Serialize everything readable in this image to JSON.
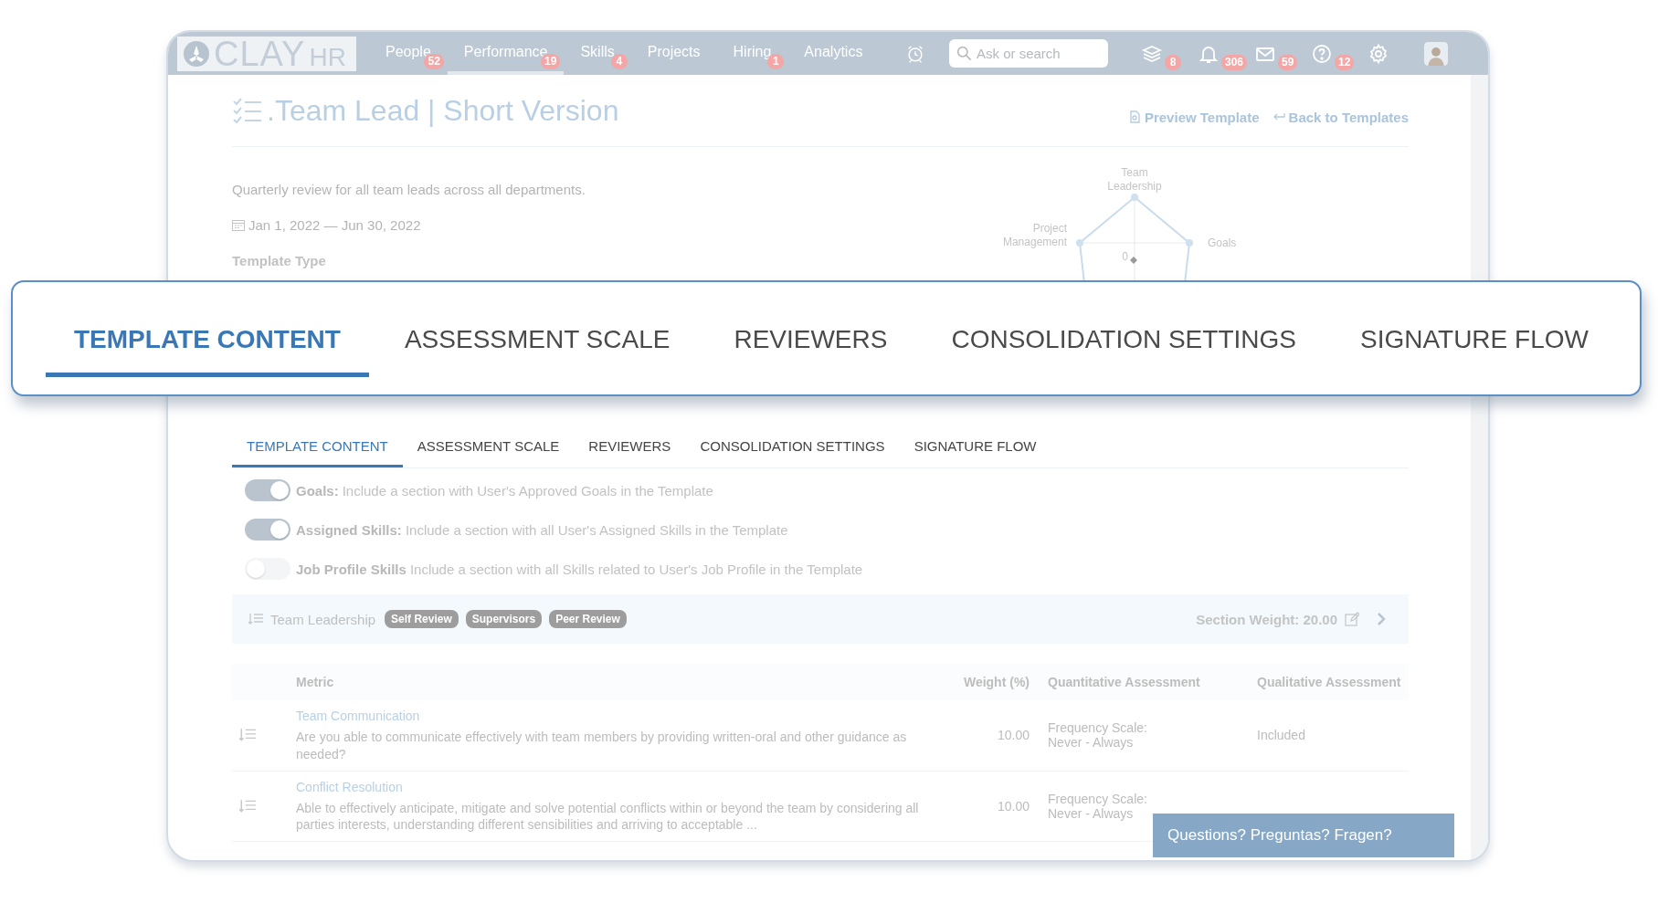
{
  "header": {
    "logo": {
      "text": "CLAY",
      "suffix": "HR"
    },
    "nav": [
      {
        "label": "People",
        "badge": "52",
        "selected": false
      },
      {
        "label": "Performance",
        "badge": "19",
        "selected": true
      },
      {
        "label": "Skills",
        "badge": "4",
        "selected": false
      },
      {
        "label": "Projects",
        "selected": false
      },
      {
        "label": "Hiring",
        "badge": "1",
        "selected": false
      },
      {
        "label": "Analytics",
        "selected": false
      }
    ],
    "search": {
      "placeholder": "Ask or search"
    },
    "icons": [
      {
        "kind": "layers",
        "badge": "8"
      },
      {
        "kind": "bell",
        "badge": "306"
      },
      {
        "kind": "mail",
        "badge": "59"
      },
      {
        "kind": "help",
        "badge": "12"
      },
      {
        "kind": "settings"
      },
      {
        "kind": "avatar"
      }
    ]
  },
  "page": {
    "title": ".Team Lead | Short Version",
    "actions": [
      {
        "kind": "preview",
        "label": "Preview Template"
      },
      {
        "kind": "back",
        "label": "Back to Templates"
      }
    ],
    "description": "Quarterly review for all team leads across all departments.",
    "date_range": "Jan 1, 2022 — Jun 30, 2022",
    "template_type_label": "Template Type"
  },
  "radar": {
    "labels": [
      "Team Leadership",
      "Goals",
      "Project Management"
    ],
    "center": "0"
  },
  "zoomed_tabs": [
    {
      "label": "TEMPLATE CONTENT",
      "selected": true
    },
    {
      "label": "ASSESSMENT SCALE",
      "selected": false
    },
    {
      "label": "REVIEWERS",
      "selected": false
    },
    {
      "label": "CONSOLIDATION SETTINGS",
      "selected": false
    },
    {
      "label": "SIGNATURE FLOW",
      "selected": false
    }
  ],
  "tabs": [
    {
      "label": "TEMPLATE CONTENT",
      "selected": true
    },
    {
      "label": "ASSESSMENT SCALE",
      "selected": false
    },
    {
      "label": "REVIEWERS",
      "selected": false
    },
    {
      "label": "CONSOLIDATION SETTINGS",
      "selected": false
    },
    {
      "label": "SIGNATURE FLOW",
      "selected": false
    }
  ],
  "toggles": [
    {
      "label": "Goals:",
      "description": "Include a section with User's Approved Goals in the Template",
      "on": true
    },
    {
      "label": "Assigned Skills:",
      "description": "Include a section with all User's Assigned Skills in the Template",
      "on": true
    },
    {
      "label": "Job Profile Skills",
      "description": "Include a section with all Skills related to User's Job Profile in the Template",
      "on": false
    }
  ],
  "section": {
    "title": "Team Leadership",
    "tags": [
      "Self Review",
      "Supervisors",
      "Peer Review"
    ],
    "weight": "Section Weight: 20.00"
  },
  "table": {
    "columns": [
      "Metric",
      "Weight (%)",
      "Quantitative Assessment",
      "Qualitative Assessment"
    ],
    "rows": [
      {
        "title": "Team Communication",
        "description": "Are you able to communicate effectively with team members by providing written-oral and other guidance as needed?",
        "weight": "10.00",
        "quantitative": "Frequency Scale: Never - Always",
        "qualitative": "Included"
      },
      {
        "title": "Conflict Resolution",
        "description": "Able to effectively anticipate, mitigate and solve potential conflicts within or beyond the team by considering all parties interests, understanding different sensibilities and arriving to acceptable ...",
        "weight": "10.00",
        "quantitative": "Frequency Scale: Never - Always"
      }
    ]
  },
  "chat_button": "Questions? Preguntas? Fragen?"
}
